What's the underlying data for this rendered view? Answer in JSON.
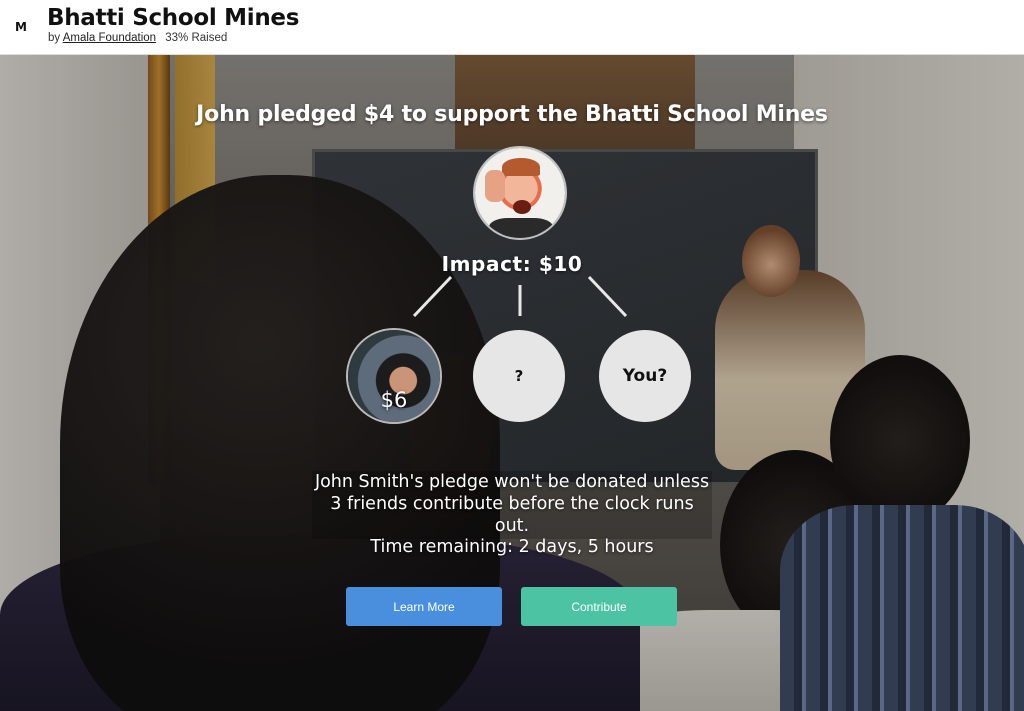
{
  "header": {
    "logo": "M",
    "title": "Bhatti School Mines",
    "by_prefix": "by",
    "organization": "Amala Foundation",
    "raised": "33% Raised"
  },
  "hero": {
    "headline": "John pledged $4 to support the Bhatti School Mines",
    "impact": "Impact: $10",
    "friend_amount": "$6",
    "unknown_label": "?",
    "you_label": "You?",
    "pledge_message": "John Smith's pledge won't be donated unless 3 friends contribute before the clock runs out.",
    "time_remaining": "Time remaining: 2 days, 5 hours"
  },
  "actions": {
    "learn_more": "Learn More",
    "contribute": "Contribute"
  },
  "colors": {
    "learn_more_button": "#4a8fde",
    "contribute_button": "#4cc4a4"
  }
}
